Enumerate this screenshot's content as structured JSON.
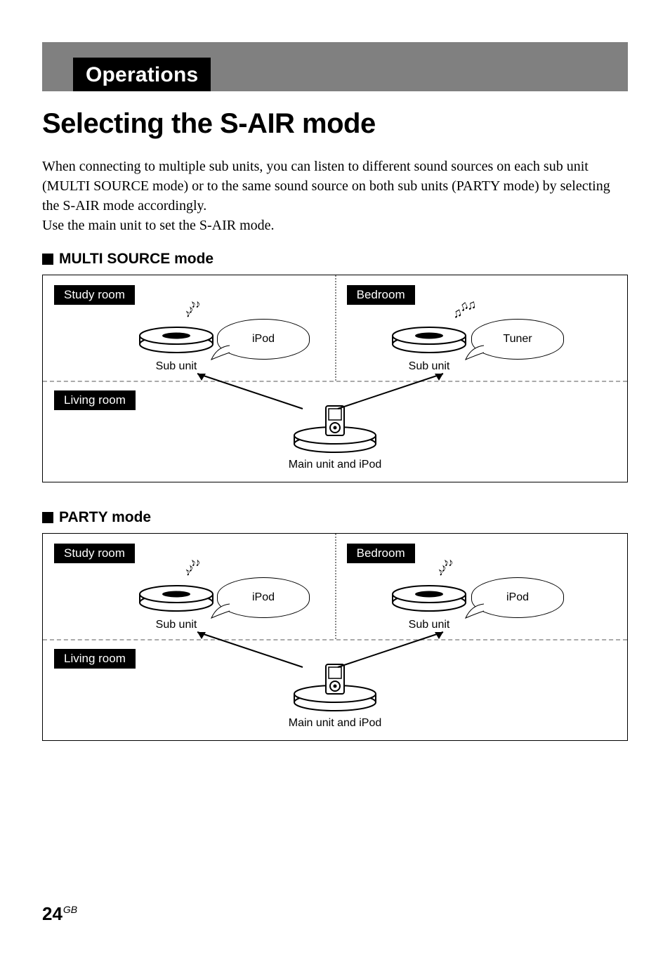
{
  "section_header": "Operations",
  "page_title": "Selecting the S-AIR mode",
  "intro_para": "When connecting to multiple sub units, you can listen to different sound sources on each sub unit (MULTI SOURCE mode) or to the same sound source on both sub units (PARTY mode) by selecting the S-AIR mode accordingly.",
  "intro_line2": "Use the main unit to set the S-AIR mode.",
  "modes": {
    "multi": {
      "heading": "MULTI SOURCE mode",
      "rooms": {
        "study": "Study room",
        "bedroom": "Bedroom",
        "living": "Living room"
      },
      "left_source": "iPod",
      "right_source": "Tuner",
      "subunit_label": "Sub unit",
      "main_label": "Main unit and iPod"
    },
    "party": {
      "heading": "PARTY mode",
      "rooms": {
        "study": "Study room",
        "bedroom": "Bedroom",
        "living": "Living room"
      },
      "left_source": "iPod",
      "right_source": "iPod",
      "subunit_label": "Sub unit",
      "main_label": "Main unit and iPod"
    }
  },
  "page_number": "24",
  "page_number_suffix": "GB"
}
